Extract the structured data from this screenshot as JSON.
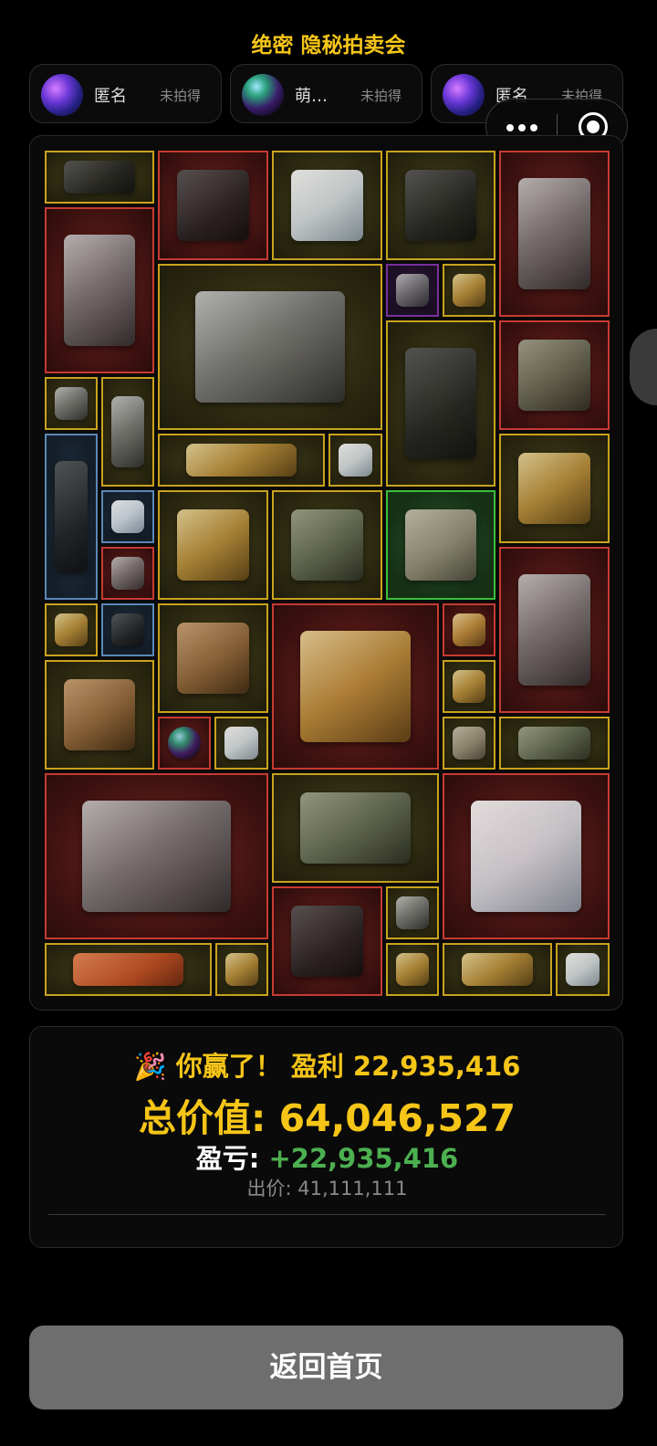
{
  "header": {
    "title": "绝密 隐秘拍卖会"
  },
  "bidders": [
    {
      "name": "匿名",
      "status": "未拍得",
      "avatar": "nebula-avatar-icon"
    },
    {
      "name": "萌…",
      "status": "未拍得",
      "avatar": "orb-avatar-icon"
    },
    {
      "name": "匿名",
      "status": "未拍得",
      "avatar": "nebula-avatar-icon"
    }
  ],
  "capsule": {
    "more_icon": "more-dots-icon",
    "close_icon": "target-close-icon"
  },
  "items": [
    {
      "name": "crossbow",
      "rarity": "gold"
    },
    {
      "name": "video-camera",
      "rarity": "red"
    },
    {
      "name": "chemical-jug",
      "rarity": "gold"
    },
    {
      "name": "medium-format-camera",
      "rarity": "gold"
    },
    {
      "name": "robot-walker",
      "rarity": "red"
    },
    {
      "name": "vacuum-cleaner",
      "rarity": "red"
    },
    {
      "name": "server-motherboard",
      "rarity": "gold"
    },
    {
      "name": "circuit-board",
      "rarity": "purple"
    },
    {
      "name": "golden-pen",
      "rarity": "gold"
    },
    {
      "name": "power-station",
      "rarity": "gold"
    },
    {
      "name": "field-radio",
      "rarity": "red"
    },
    {
      "name": "ssd-drive",
      "rarity": "gold"
    },
    {
      "name": "gas-cylinder",
      "rarity": "gold"
    },
    {
      "name": "voice-recorder",
      "rarity": "blue"
    },
    {
      "name": "golden-tiara",
      "rarity": "gold"
    },
    {
      "name": "pulse-oximeter",
      "rarity": "gold"
    },
    {
      "name": "satellite-dish",
      "rarity": "gold"
    },
    {
      "name": "mp3-player",
      "rarity": "blue"
    },
    {
      "name": "binoculars",
      "rarity": "gold"
    },
    {
      "name": "winged-lion-statue",
      "rarity": "green"
    },
    {
      "name": "satellite-dish",
      "rarity": "gold"
    },
    {
      "name": "usb-flash-drive",
      "rarity": "red"
    },
    {
      "name": "robot-walker",
      "rarity": "red"
    },
    {
      "name": "medal",
      "rarity": "gold"
    },
    {
      "name": "tin-can",
      "rarity": "blue"
    },
    {
      "name": "bronze-pedestal-clock",
      "rarity": "gold"
    },
    {
      "name": "jeweled-egg",
      "rarity": "red"
    },
    {
      "name": "caviar-tin",
      "rarity": "red"
    },
    {
      "name": "sardine-tin",
      "rarity": "gold"
    },
    {
      "name": "bronze-pedestal-clock",
      "rarity": "gold"
    },
    {
      "name": "iridescent-orb",
      "rarity": "red"
    },
    {
      "name": "usb-dongle",
      "rarity": "gold"
    },
    {
      "name": "sandwich",
      "rarity": "gold"
    },
    {
      "name": "rugged-device",
      "rarity": "gold"
    },
    {
      "name": "storage-server",
      "rarity": "red"
    },
    {
      "name": "military-radio-set",
      "rarity": "gold"
    },
    {
      "name": "medical-monitor",
      "rarity": "red"
    },
    {
      "name": "video-camera",
      "rarity": "red"
    },
    {
      "name": "cpu-chip",
      "rarity": "gold"
    },
    {
      "name": "orange-case",
      "rarity": "gold"
    },
    {
      "name": "sardine-tin",
      "rarity": "gold"
    },
    {
      "name": "medal",
      "rarity": "gold"
    },
    {
      "name": "aviator-sunglasses",
      "rarity": "gold"
    },
    {
      "name": "usb-stick",
      "rarity": "gold"
    }
  ],
  "result": {
    "win_icon": "party-popper-icon",
    "win_text": "你赢了！ 盈利 22,935,416",
    "total_label": "总价值:",
    "total_value": "64,046,527",
    "pnl_label": "盈亏:",
    "pnl_value": "+22,935,416",
    "bid_label": "出价:",
    "bid_value": "41,111,111"
  },
  "footer": {
    "home_button": "返回首页"
  },
  "colors": {
    "gold": "#c9a21d",
    "red": "#c63a33",
    "blue": "#5a88b5",
    "purple": "#7a2f9a",
    "green": "#3cbf3c",
    "profit": "#4caf50",
    "title": "#f5c518"
  }
}
